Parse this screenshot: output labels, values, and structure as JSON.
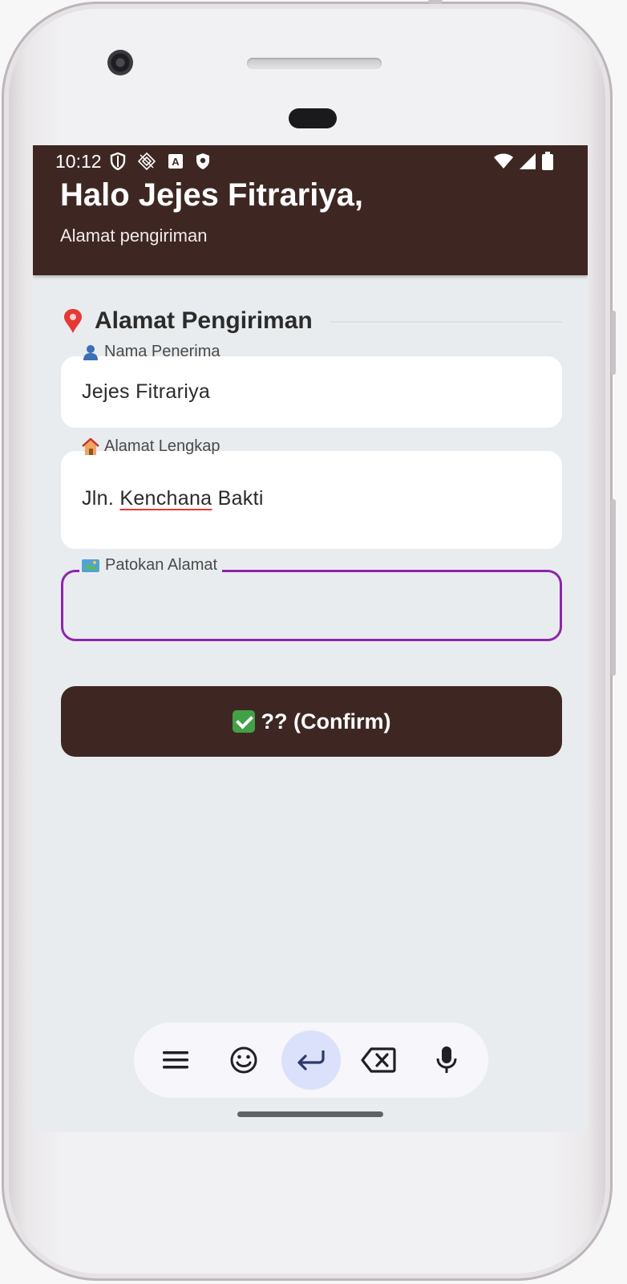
{
  "status_bar": {
    "time": "10:12",
    "left_icons": [
      "shield-icon",
      "satellite-icon",
      "keyboard-a-icon",
      "play-protect-icon"
    ],
    "right_icons": [
      "wifi-icon",
      "cell-signal-icon",
      "battery-icon"
    ]
  },
  "header": {
    "greeting": "Halo Jejes Fitrariya,",
    "subtitle": "Alamat pengiriman"
  },
  "section": {
    "icon": "pin-icon",
    "title": "Alamat Pengiriman"
  },
  "form": {
    "recipient": {
      "icon": "person-icon",
      "label": "Nama Penerima",
      "value": "Jejes Fitrariya"
    },
    "address": {
      "icon": "house-icon",
      "label": "Alamat Lengkap",
      "value_parts": [
        "Jln. ",
        "Kenchana",
        " Bakti"
      ]
    },
    "landmark": {
      "icon": "map-icon",
      "label": "Patokan Alamat",
      "value": ""
    }
  },
  "confirm_button": {
    "icon": "check-icon",
    "label": "?? (Confirm)"
  },
  "keyboard_toolbar": {
    "buttons": [
      "menu-icon",
      "emoji-icon",
      "enter-icon",
      "backspace-icon",
      "mic-icon"
    ],
    "active_button": "enter-icon"
  },
  "colors": {
    "primary_dark": "#3e2723",
    "focus_accent": "#8e24aa",
    "background": "#e9ecef",
    "spellcheck": "#e53935",
    "success": "#43a047"
  }
}
